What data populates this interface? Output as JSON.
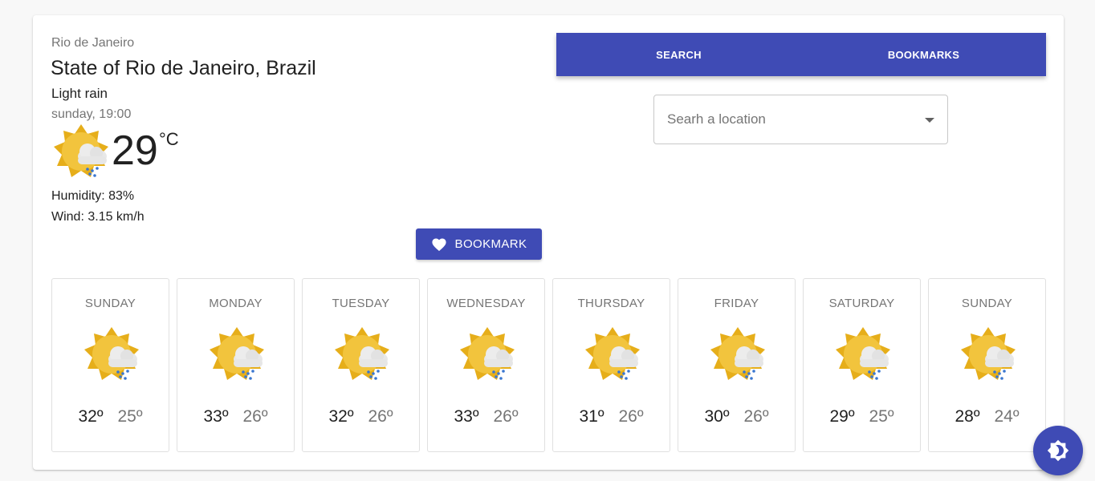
{
  "location": {
    "city": "Rio de Janeiro",
    "region": "State of Rio de Janeiro, Brazil"
  },
  "current": {
    "condition": "Light rain",
    "time": "sunday, 19:00",
    "temperature": "29",
    "unit": "°C",
    "humidity": "Humidity: 83%",
    "wind": "Wind: 3.15 km/h",
    "icon": "sun-cloud-rain-icon"
  },
  "actions": {
    "bookmark_label": "BOOKMARK"
  },
  "tabs": [
    {
      "label": "SEARCH"
    },
    {
      "label": "BOOKMARKS"
    }
  ],
  "search": {
    "placeholder": "Searh a location"
  },
  "forecast": [
    {
      "day": "SUNDAY",
      "high": "32º",
      "low": "25º"
    },
    {
      "day": "MONDAY",
      "high": "33º",
      "low": "26º"
    },
    {
      "day": "TUESDAY",
      "high": "32º",
      "low": "26º"
    },
    {
      "day": "WEDNESDAY",
      "high": "33º",
      "low": "26º"
    },
    {
      "day": "THURSDAY",
      "high": "31º",
      "low": "26º"
    },
    {
      "day": "FRIDAY",
      "high": "30º",
      "low": "26º"
    },
    {
      "day": "SATURDAY",
      "high": "29º",
      "low": "25º"
    },
    {
      "day": "SUNDAY",
      "high": "28º",
      "low": "24º"
    }
  ],
  "colors": {
    "primary": "#3f4bb5",
    "sun": "#f2c43d",
    "sun_ray": "#e6ae1a",
    "cloud": "#e8e8e8",
    "rain": "#3a77d0"
  }
}
